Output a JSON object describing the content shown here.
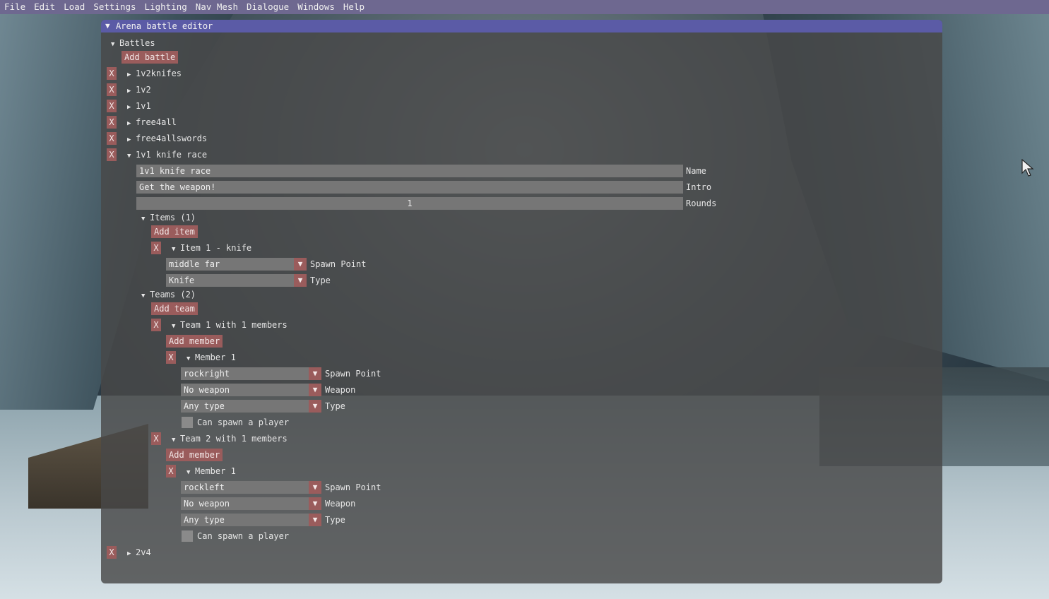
{
  "menu": [
    "File",
    "Edit",
    "Load",
    "Settings",
    "Lighting",
    "Nav Mesh",
    "Dialogue",
    "Windows",
    "Help"
  ],
  "window": {
    "title": "Arena battle editor",
    "battles_header": "Battles",
    "add_battle": "Add battle",
    "x_label": "X",
    "battles": [
      "1v2knifes",
      "1v2",
      "1v1",
      "free4all",
      "free4allswords",
      "1v1 knife race"
    ],
    "last_battle": "2v4",
    "open_battle": {
      "name_value": "1v1 knife race",
      "name_label": "Name",
      "intro_value": "Get the weapon!",
      "intro_label": "Intro",
      "rounds_value": "1",
      "rounds_label": "Rounds",
      "items_header": "Items (1)",
      "add_item": "Add item",
      "item1_header": "Item 1 - knife",
      "item1_spawn": "middle far",
      "spawn_label": "Spawn Point",
      "item1_type": "Knife",
      "type_label": "Type",
      "teams_header": "Teams (2)",
      "add_team": "Add team",
      "add_member": "Add member",
      "member_header": "Member 1",
      "weapon_label": "Weapon",
      "can_spawn_label": "Can spawn a player",
      "team1": {
        "header": "Team 1 with 1 members",
        "spawn": "rockright",
        "weapon": "No weapon",
        "type": "Any type"
      },
      "team2": {
        "header": "Team 2 with 1 members",
        "spawn": "rockleft",
        "weapon": "No weapon",
        "type": "Any type"
      }
    }
  },
  "colors": {
    "menubar": "#6e6890",
    "titlebar": "#5b5ba6",
    "button": "#9a5c5c",
    "field": "#767676"
  }
}
